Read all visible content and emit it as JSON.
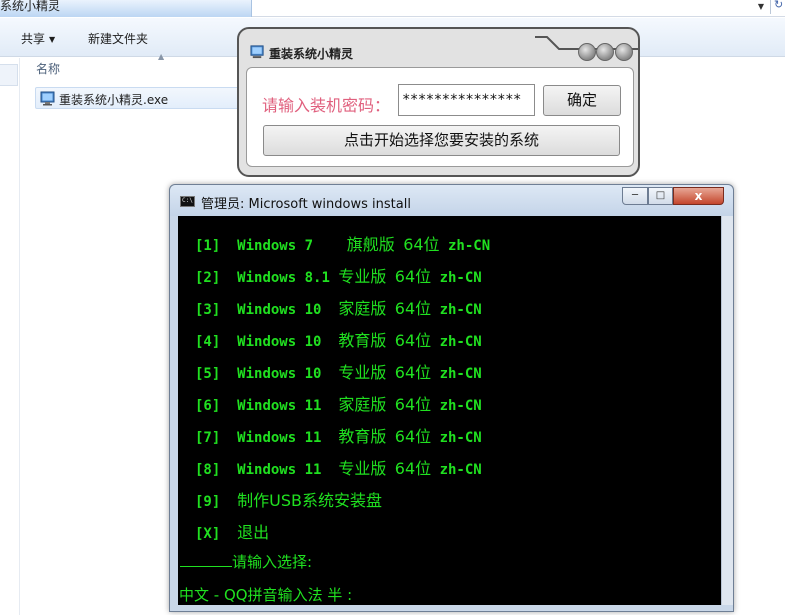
{
  "explorer": {
    "address_text": "系统小精灵",
    "toolbar": {
      "share_label": "共享",
      "new_folder_label": "新建文件夹"
    },
    "column_header": "名称",
    "file_name": "重装系统小精灵.exe"
  },
  "popup": {
    "title": "重装系统小精灵",
    "password_label": "请输入装机密码：",
    "password_value": "***************",
    "ok_label": "确定",
    "start_label": "点击开始选择您要安装的系统"
  },
  "console": {
    "title": "管理员:  Microsoft windows install",
    "close_glyph": "x",
    "options": [
      {
        "key": "[1]",
        "name": "Windows 7  ",
        "edition": "旗舰版",
        "arch": "64位",
        "lang": "zh-CN"
      },
      {
        "key": "[2]",
        "name": "Windows 8.1",
        "edition": "专业版",
        "arch": "64位",
        "lang": "zh-CN"
      },
      {
        "key": "[3]",
        "name": "Windows 10 ",
        "edition": "家庭版",
        "arch": "64位",
        "lang": "zh-CN"
      },
      {
        "key": "[4]",
        "name": "Windows 10 ",
        "edition": "教育版",
        "arch": "64位",
        "lang": "zh-CN"
      },
      {
        "key": "[5]",
        "name": "Windows 10 ",
        "edition": "专业版",
        "arch": "64位",
        "lang": "zh-CN"
      },
      {
        "key": "[6]",
        "name": "Windows 11 ",
        "edition": "家庭版",
        "arch": "64位",
        "lang": "zh-CN"
      },
      {
        "key": "[7]",
        "name": "Windows 11 ",
        "edition": "教育版",
        "arch": "64位",
        "lang": "zh-CN"
      },
      {
        "key": "[8]",
        "name": "Windows 11 ",
        "edition": "专业版",
        "arch": "64位",
        "lang": "zh-CN"
      }
    ],
    "option_usb": {
      "key": "[9]",
      "label": "制作USB系统安装盘"
    },
    "option_exit": {
      "key": "[X]",
      "label": "退出"
    },
    "prompt": "请输入选择:",
    "ime_status": "中文 - QQ拼音输入法 半 :"
  },
  "colors": {
    "console_text": "#20e020",
    "password_label": "#e0607e",
    "close_button": "#c4462c"
  }
}
